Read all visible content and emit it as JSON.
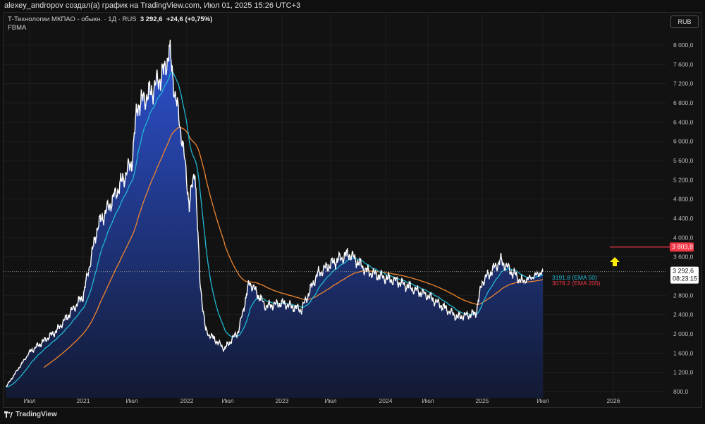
{
  "header": {
    "attribution": "alexey_andropov создал(а) график на TradingView.com, Июл 01, 2025 15:26 UTC+3"
  },
  "legend": {
    "symbol": "Т-Технологии МКПАО - обыкн. · 1Д · RUS",
    "price": "3 292,6",
    "change": "+24,6 (+0,75%)",
    "ticker": "FBMA"
  },
  "currency_button": "RUB",
  "footer": {
    "brand": "TradingView"
  },
  "colors": {
    "price_line": "#ffffff",
    "fill_top": "#2d52d2",
    "fill_bottom": "#131a33",
    "ema50": "#1fb7d4",
    "ema200": "#f0852d",
    "target": "#f23645",
    "arrow": "#ffeb00"
  },
  "chart_data": {
    "type": "area",
    "title": "Т-Технологии МКПАО - обыкн. · 1Д · RUS",
    "ylim": [
      700,
      8600
    ],
    "y_ticks": [
      800,
      1200,
      1600,
      2000,
      2400,
      2800,
      3200,
      3600,
      4000,
      4400,
      4800,
      5200,
      5600,
      6000,
      6400,
      6800,
      7200,
      7600,
      8000
    ],
    "y_tick_labels": [
      "800,0",
      "1 200,0",
      "1 600,0",
      "2 000,0",
      "2 400,0",
      "2 800,0",
      "3 200,0",
      "3 600,0",
      "4 000,0",
      "4 400,0",
      "4 800,0",
      "5 200,0",
      "5 600,0",
      "6 000,0",
      "6 400,0",
      "6 800,0",
      "7 200,0",
      "7 600,0",
      "8 000,0"
    ],
    "x_ticks": [
      {
        "t": 2020.5,
        "label": "Июл"
      },
      {
        "t": 2021.0,
        "label": "2021"
      },
      {
        "t": 2021.5,
        "label": "Июл"
      },
      {
        "t": 2022.0,
        "label": "2022"
      },
      {
        "t": 2022.5,
        "label": "Июл"
      },
      {
        "t": 2023.0,
        "label": "2023"
      },
      {
        "t": 2023.5,
        "label": "Июл"
      },
      {
        "t": 2024.0,
        "label": "2024"
      },
      {
        "t": 2024.5,
        "label": "Июл"
      },
      {
        "t": 2025.0,
        "label": "2025"
      },
      {
        "t": 2025.5,
        "label": "Июл"
      },
      {
        "t": 2026.0,
        "label": "2026"
      }
    ],
    "series": [
      {
        "name": "Close",
        "t": [
          2020.28,
          2020.5,
          2020.75,
          2021.0,
          2021.15,
          2021.28,
          2021.5,
          2021.55,
          2021.68,
          2021.8,
          2021.84,
          2021.9,
          2021.96,
          2022.03,
          2022.1,
          2022.16,
          2022.23,
          2022.46,
          2022.6,
          2022.7,
          2022.85,
          2023.0,
          2023.2,
          2023.36,
          2023.5,
          2023.67,
          2023.83,
          2024.0,
          2024.15,
          2024.5,
          2024.77,
          2024.94,
          2025.0,
          2025.15,
          2025.33,
          2025.5
        ],
        "values": [
          900,
          1620,
          2060,
          2790,
          4250,
          4700,
          5570,
          6740,
          7040,
          7480,
          7900,
          6890,
          6010,
          4690,
          5430,
          3080,
          2060,
          1690,
          2060,
          3080,
          2570,
          2640,
          2500,
          3230,
          3450,
          3670,
          3300,
          3160,
          3080,
          2790,
          2350,
          2420,
          3080,
          3520,
          3080,
          3292.6
        ]
      },
      {
        "name": "EMA 50",
        "last": "3191.8",
        "label": "3191.8 (EMA 50)"
      },
      {
        "name": "EMA 200",
        "last": "3078.2",
        "label": "3078.2 (EMA 200)"
      }
    ],
    "last_price": {
      "value": 3292.6,
      "label": "3 292,6",
      "countdown": "08:23:15"
    },
    "target_line": {
      "value": 3803.8,
      "label": "3 803,8",
      "t_start": 2026.0
    }
  }
}
